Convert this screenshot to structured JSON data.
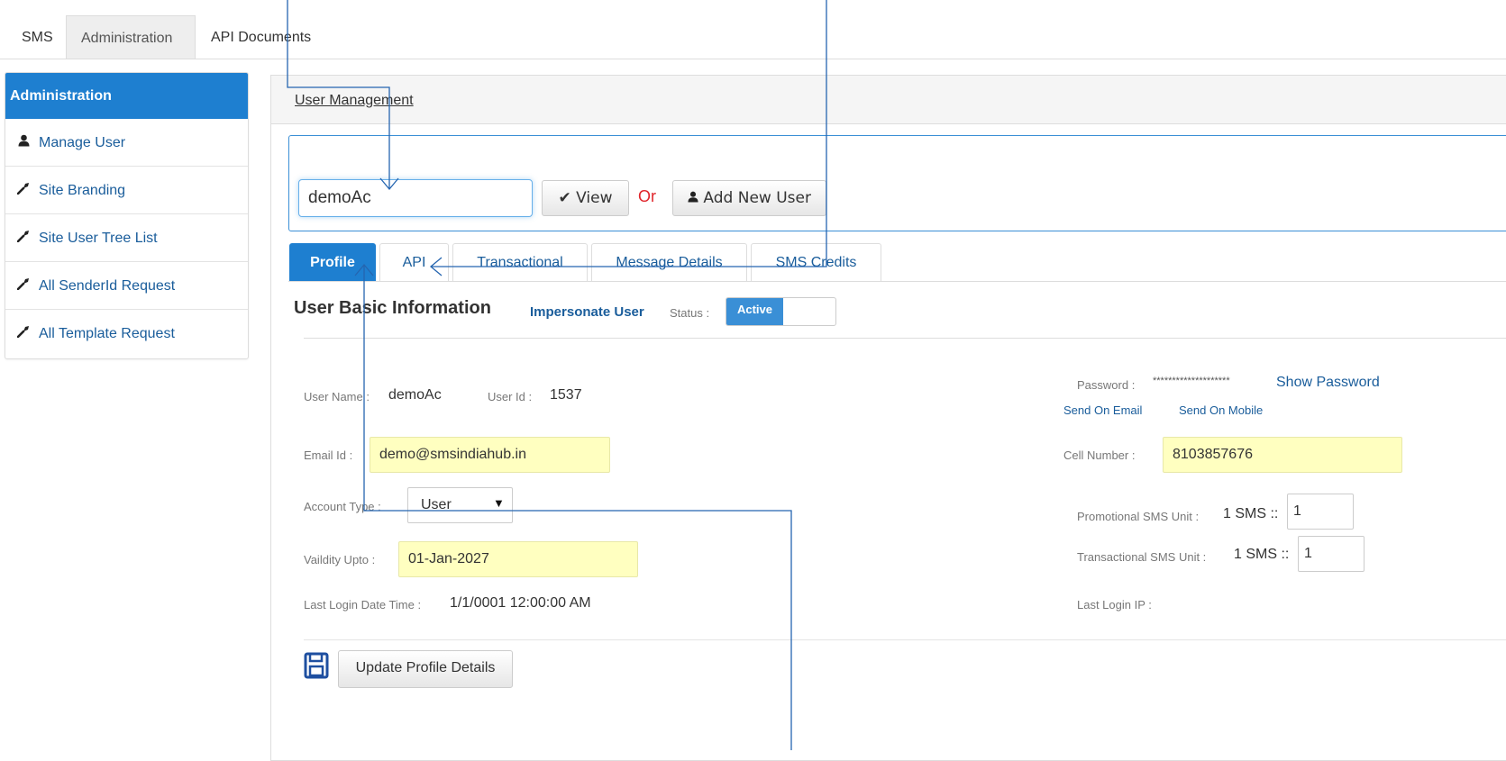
{
  "topnav": {
    "tabs": [
      {
        "label": "SMS"
      },
      {
        "label": "Administration"
      },
      {
        "label": "API Documents"
      }
    ]
  },
  "sidebar": {
    "title": "Administration",
    "items": [
      {
        "label": "Manage User",
        "icon": "user-icon"
      },
      {
        "label": "Site Branding",
        "icon": "wrench-icon"
      },
      {
        "label": "Site User Tree List",
        "icon": "wrench-icon"
      },
      {
        "label": "All SenderId Request",
        "icon": "wrench-icon"
      },
      {
        "label": "All Template Request",
        "icon": "wrench-icon"
      }
    ]
  },
  "main": {
    "title": "User Management",
    "search": {
      "value": "demoAc",
      "view_label": "View",
      "or_label": "Or",
      "add_label": "Add New User"
    },
    "tabs": [
      {
        "label": "Profile"
      },
      {
        "label": "API"
      },
      {
        "label": "Transactional"
      },
      {
        "label": "Message Details"
      },
      {
        "label": "SMS Credits"
      }
    ],
    "section_title": "User Basic Information",
    "impersonate_label": "Impersonate User",
    "status_label": "Status :",
    "status_value": "Active",
    "profile": {
      "user_name_label": "User Name :",
      "user_name": "demoAc",
      "user_id_label": "User Id :",
      "user_id": "1537",
      "email_label": "Email Id :",
      "email": "demo@smsindiahub.in",
      "account_type_label": "Account Type :",
      "account_type": "User",
      "validity_label": "Vaildity Upto :",
      "validity": "01-Jan-2027",
      "last_login_label": "Last Login Date Time :",
      "last_login": "1/1/0001 12:00:00 AM",
      "password_label": "Password :",
      "password_mask": "********************",
      "show_password": "Show Password",
      "send_email": "Send On Email",
      "send_mobile": "Send On Mobile",
      "cell_label": "Cell Number :",
      "cell": "8103857676",
      "promo_label": "Promotional SMS Unit :",
      "promo_unit": "1 SMS ::",
      "promo_value": "1",
      "trans_label": "Transactional SMS Unit :",
      "trans_unit": "1 SMS ::",
      "trans_value": "1",
      "last_ip_label": "Last Login IP :"
    },
    "update_label": "Update Profile Details"
  },
  "colors": {
    "accent": "#1e7fd0",
    "link": "#1a5d9b",
    "or_red": "#e0252b",
    "highlight_field": "#ffffc0",
    "annotation_line": "#2565b0"
  }
}
